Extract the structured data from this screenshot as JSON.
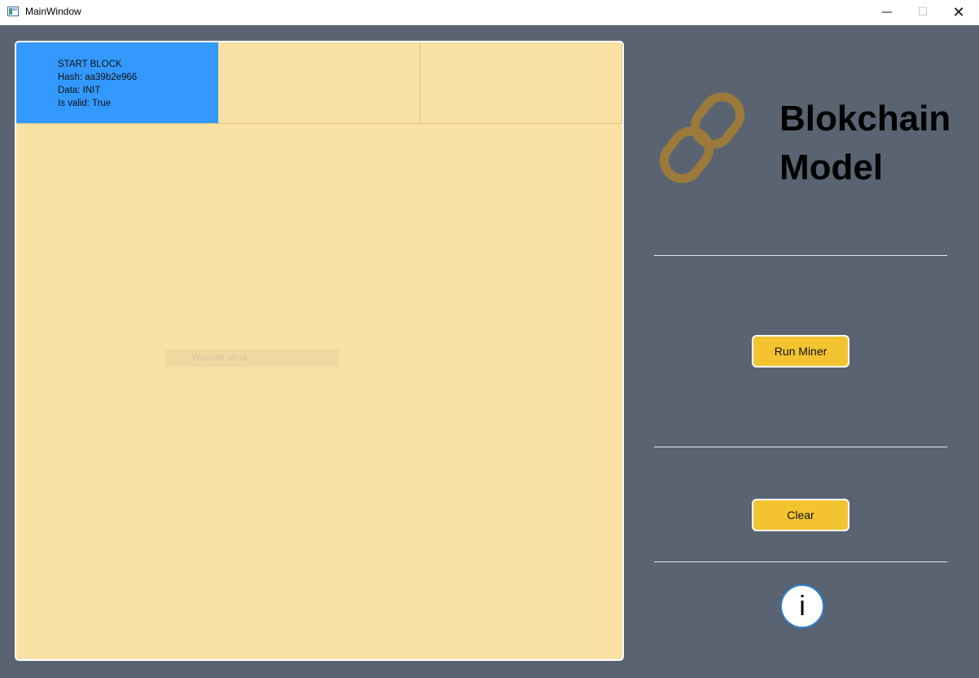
{
  "window": {
    "title": "MainWindow",
    "controls": {
      "minimize": "—",
      "maximize": "☐",
      "close": "✕"
    }
  },
  "chain": {
    "blocks": [
      {
        "type": "START BLOCK",
        "hash": "Hash: aa39b2e966",
        "data": "Data: INIT",
        "valid": "Is valid: True"
      }
    ],
    "snip_label": "Wycinek okna"
  },
  "sidebar": {
    "title_line1": "Blokchain",
    "title_line2": "Model",
    "run_button": "Run Miner",
    "clear_button": "Clear",
    "info_button": "i"
  },
  "colors": {
    "background": "#596371",
    "panel": "#fae1a4",
    "block_highlight": "#3399ff",
    "button": "#f4c430",
    "logo": "#9b7a3c"
  },
  "icons": {
    "logo": "chain-link-icon",
    "app": "window-app-icon"
  }
}
